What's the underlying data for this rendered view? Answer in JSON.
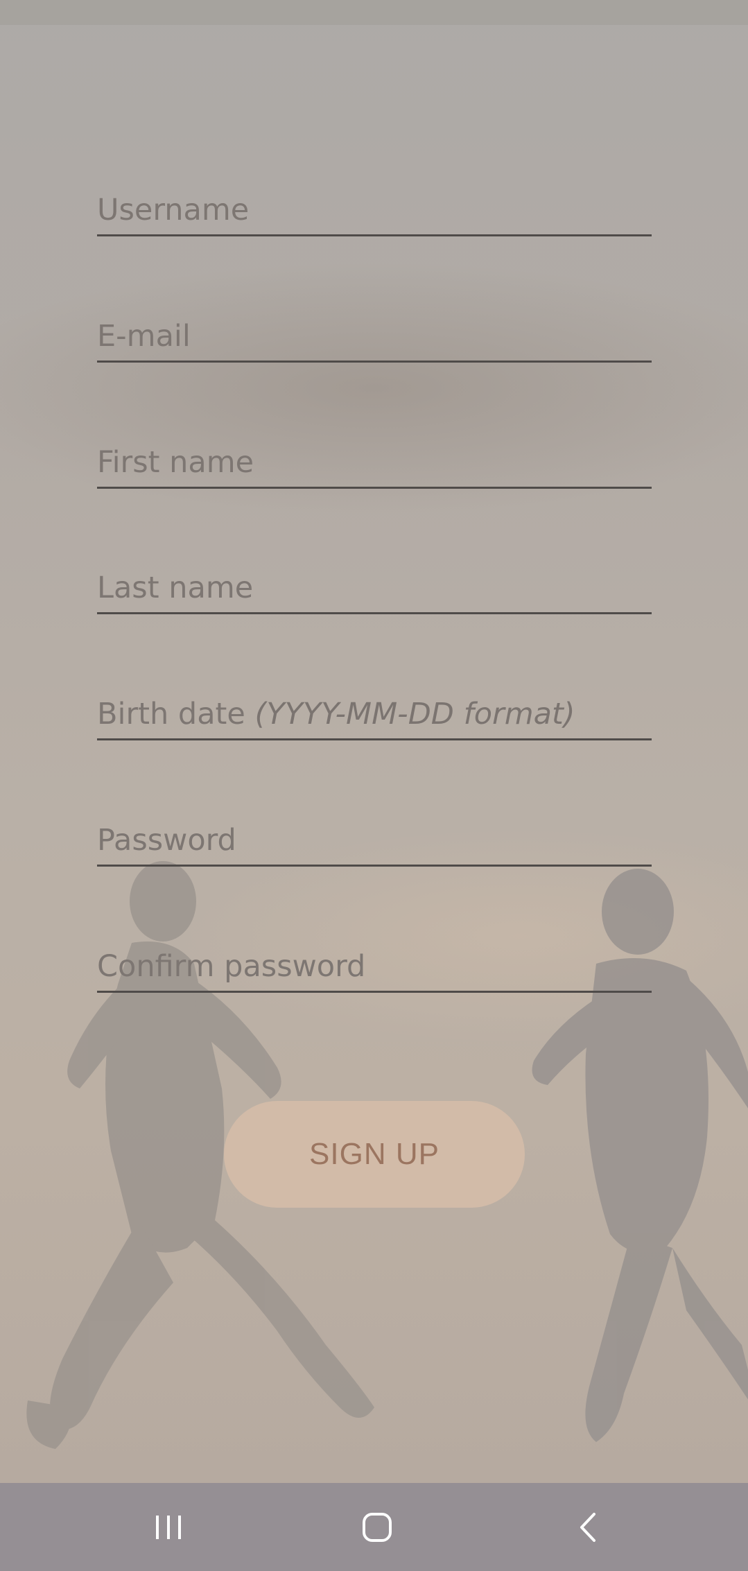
{
  "form": {
    "fields": [
      {
        "placeholder": "Username",
        "hint": ""
      },
      {
        "placeholder": "E-mail",
        "hint": ""
      },
      {
        "placeholder": "First name",
        "hint": ""
      },
      {
        "placeholder": "Last name",
        "hint": ""
      },
      {
        "placeholder": "Birth date",
        "hint": "(YYYY-MM-DD format)"
      },
      {
        "placeholder": "Password",
        "hint": ""
      },
      {
        "placeholder": "Confirm password",
        "hint": ""
      }
    ],
    "signup_label": "SIGN UP"
  },
  "navbar": {
    "recents_icon": "recents-icon",
    "home_icon": "home-icon",
    "back_icon": "back-icon"
  },
  "colors": {
    "button_bg": "#d2bba8",
    "button_text": "#9b7560",
    "underline": "#4f4b49",
    "navbar_bg": "#958f94"
  }
}
